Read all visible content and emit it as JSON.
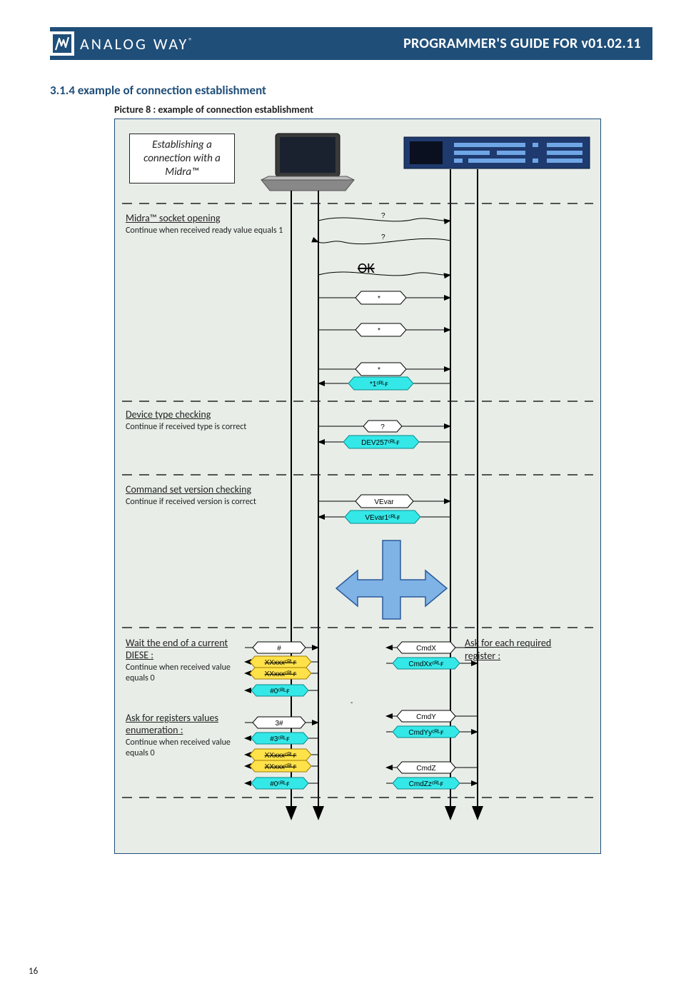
{
  "header": {
    "brand": "ANALOG WAY",
    "doc_title": "PROGRAMMER'S GUIDE FOR v01.02.11"
  },
  "section": {
    "number_title": "3.1.4  example of connection establishment",
    "caption": "Picture 8 : example of connection establishment"
  },
  "diagram": {
    "title_box": "Establishing a connection with a Midra™",
    "step1": {
      "title": "Midra™ socket opening",
      "sub": "Continue when received ready value equals 1"
    },
    "step2": {
      "title": "Device type checking",
      "sub": "Continue if received type is correct"
    },
    "step3": {
      "title": "Command set version checking",
      "sub": "Continue if received version is correct"
    },
    "step4": {
      "title": "Wait the end of a current DIESE :",
      "sub": "Continue when received value equals 0"
    },
    "step5": {
      "title": "Ask for registers values enumeration :",
      "sub": "Continue when received value equals 0"
    },
    "right": {
      "title": "Ask for each required register :"
    },
    "ok": "OK",
    "msgs": {
      "star": "*",
      "star1": "*1ᶜᴿᴸꜰ",
      "q": "?",
      "dev": "DEV257ᶜᴿᴸꜰ",
      "vevar": "VEvar",
      "vevar1": "VEvar1ᶜᴿᴸꜰ",
      "hash": "#",
      "xx1": "XXxxxᶜᴿᴸꜰ",
      "xx2": "XXxxxᶜᴿᴸꜰ",
      "h0": "#0ᶜᴿᴸꜰ",
      "three": "3#",
      "h3": "#3ᶜᴿᴸꜰ",
      "cmdx": "CmdX",
      "cmdxx": "CmdXxᶜᴿᴸꜰ",
      "cmdy": "CmdY",
      "cmdyy": "CmdYyᶜᴿᴸꜰ",
      "cmdz": "CmdZ",
      "cmdzz": "CmdZzᶜᴿᴸꜰ"
    }
  },
  "page": "16"
}
